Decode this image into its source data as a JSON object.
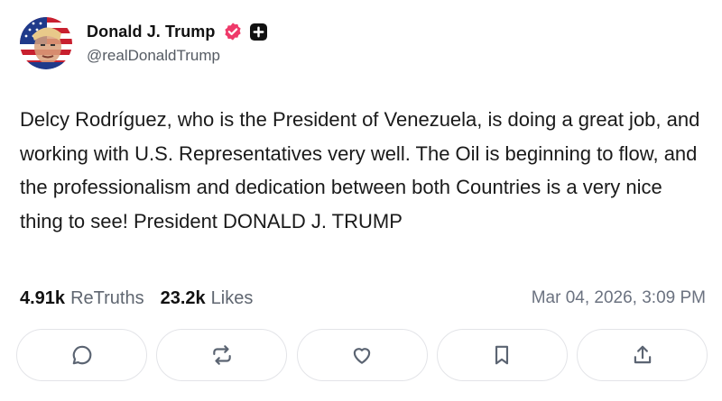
{
  "author": {
    "display_name": "Donald J. Trump",
    "handle": "@realDonaldTrump",
    "avatar_icon": "flag-portrait-avatar",
    "verified_icon": "verified-badge-icon",
    "plus_icon": "plus-badge-icon"
  },
  "post": {
    "text": "Delcy Rodríguez, who is the President of Venezuela, is doing a great job, and working with U.S. Representatives very well. The Oil is beginning to flow, and the professionalism and dedication between both Countries is a very nice thing to see! President DONALD J. TRUMP"
  },
  "stats": {
    "retruths_count": "4.91k",
    "retruths_label": "ReTruths",
    "likes_count": "23.2k",
    "likes_label": "Likes",
    "timestamp": "Mar 04, 2026, 3:09 PM"
  },
  "actions": [
    {
      "icon": "reply-icon"
    },
    {
      "icon": "retruth-icon"
    },
    {
      "icon": "like-icon"
    },
    {
      "icon": "bookmark-icon"
    },
    {
      "icon": "share-icon"
    }
  ],
  "colors": {
    "verified": "#ef3a6a",
    "icon": "#5b6472",
    "border": "#e3e4e8"
  }
}
